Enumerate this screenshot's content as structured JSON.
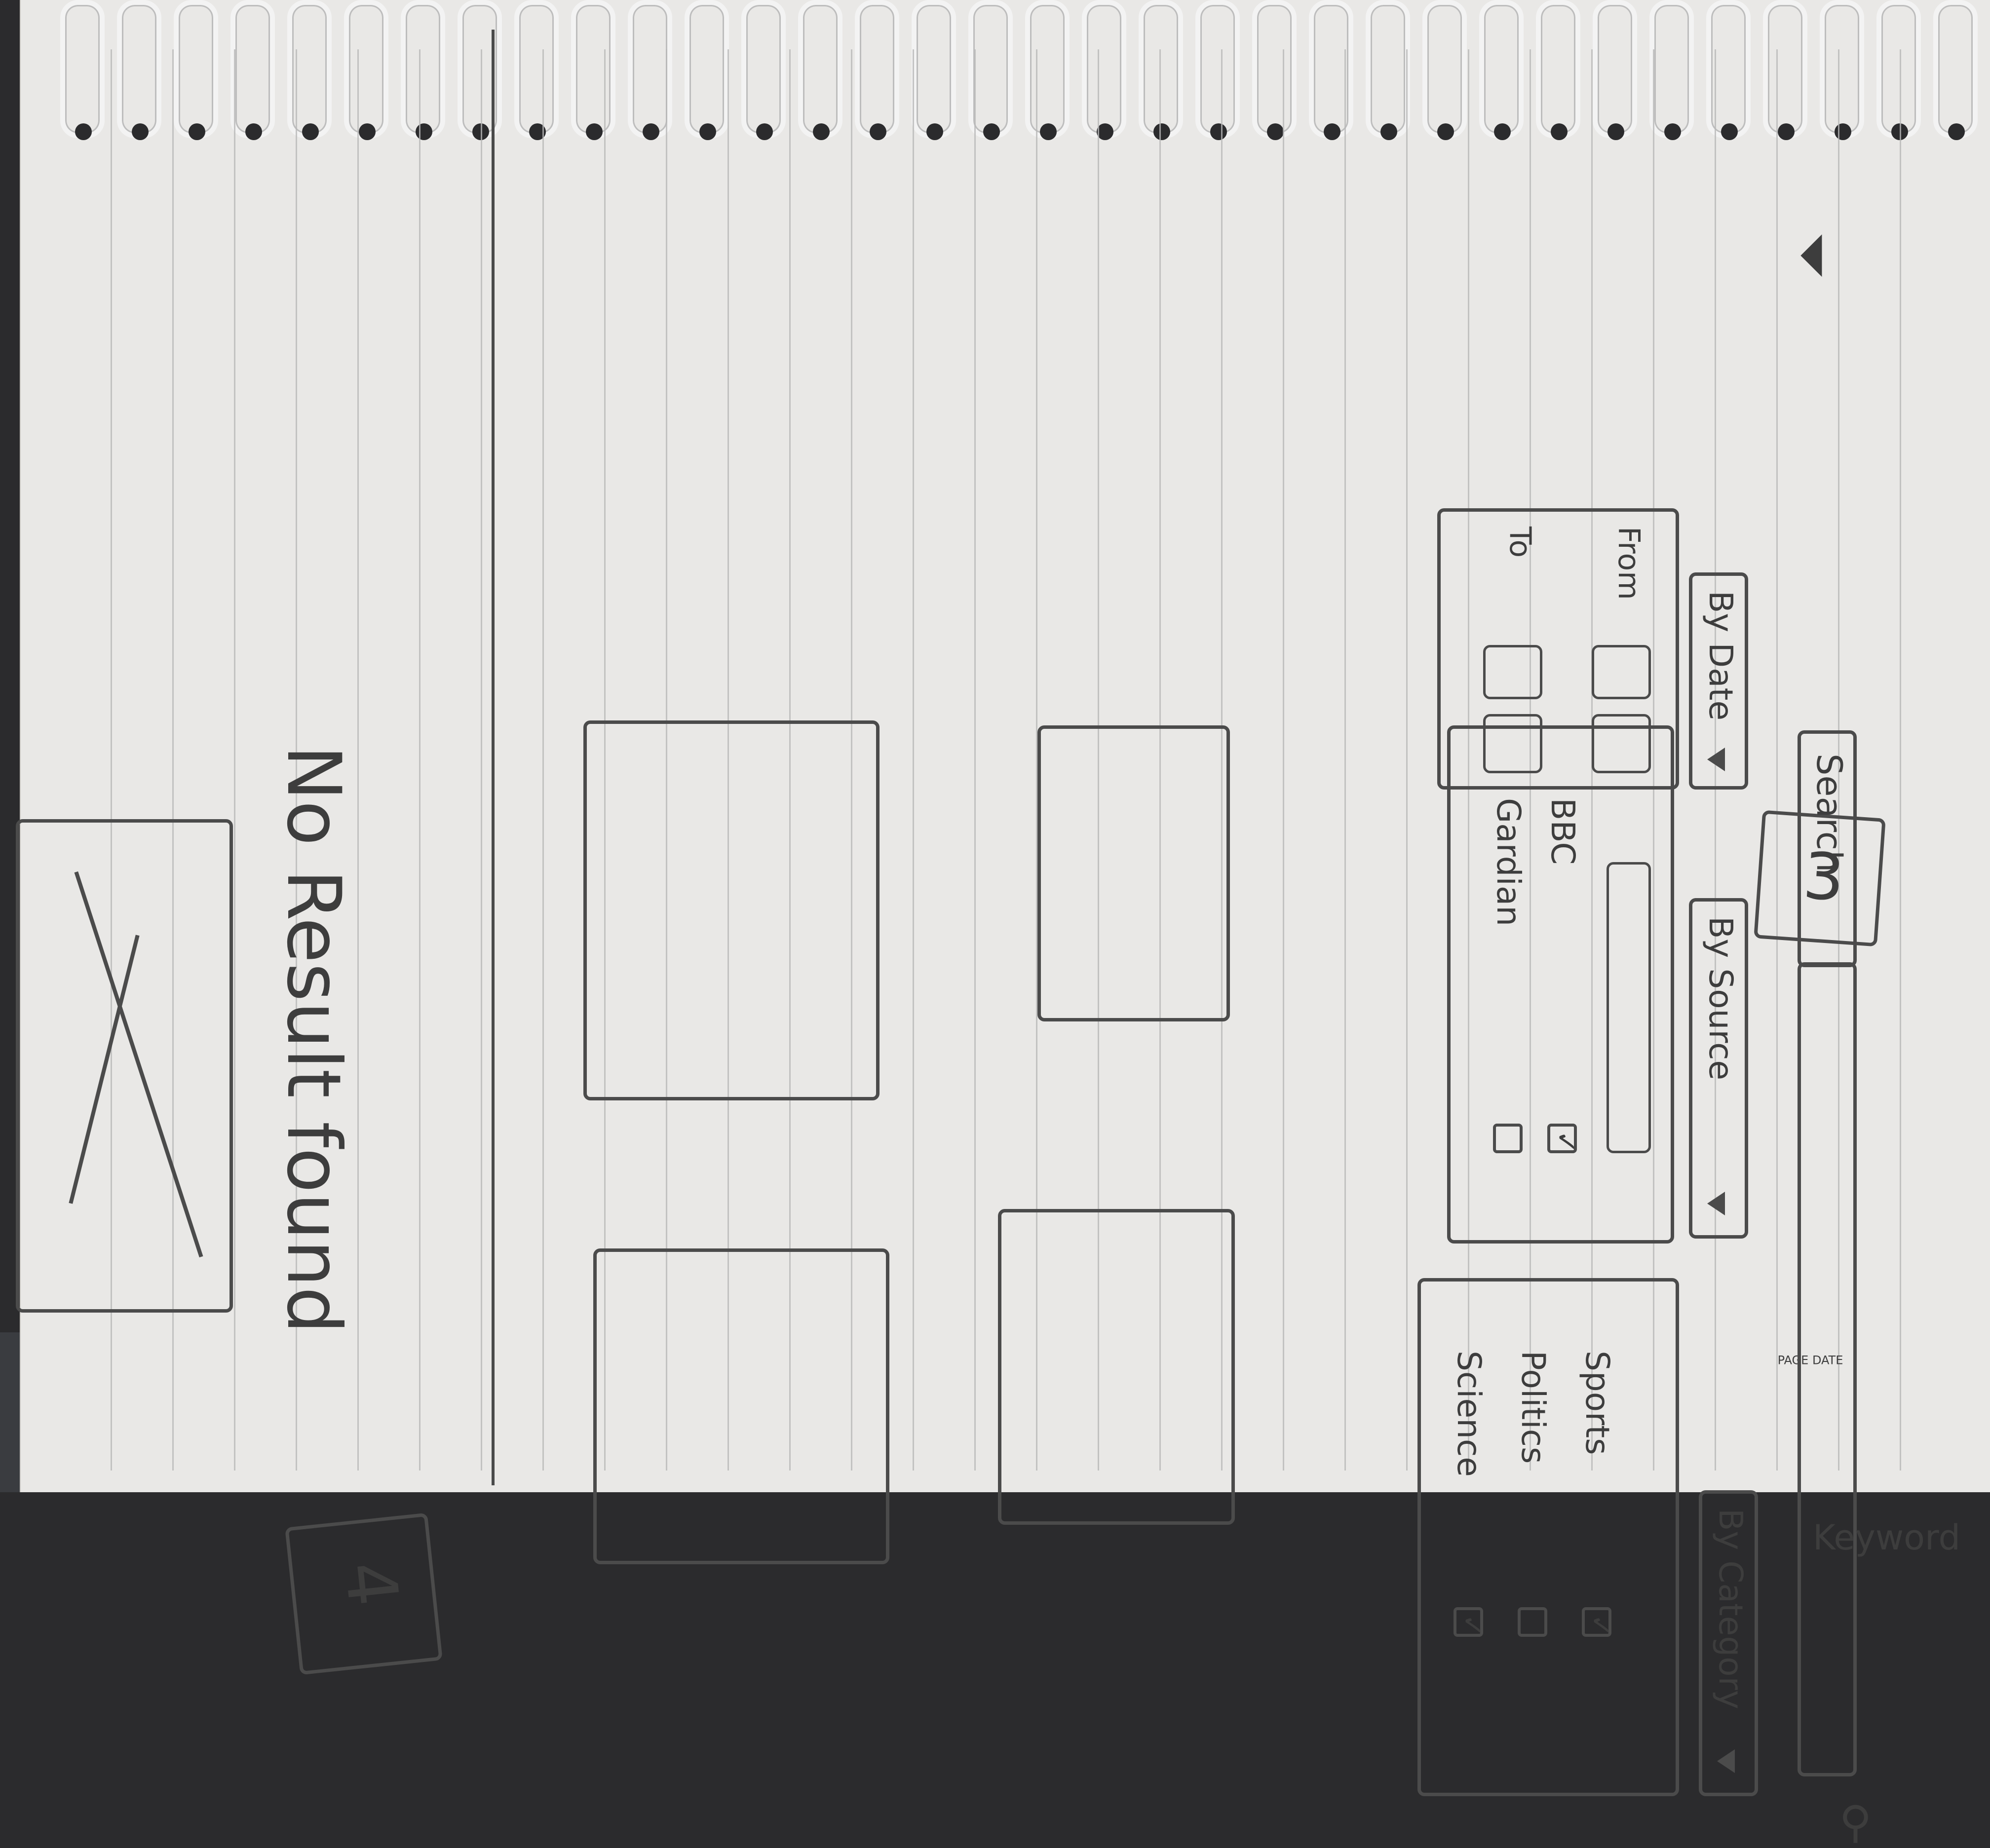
{
  "page": {
    "page_number": "3",
    "header_label": "PAGE\nDATE",
    "keyword_placeholder": "Keyword",
    "search_label": "Search"
  },
  "filters": {
    "category": {
      "label": "By Category",
      "items": [
        {
          "label": "Sports",
          "checked": true
        },
        {
          "label": "Politics",
          "checked": false
        },
        {
          "label": "Science",
          "checked": true
        }
      ]
    },
    "source": {
      "label": "By Source",
      "items": [
        {
          "label": "BBC",
          "checked": true
        },
        {
          "label": "Gardian",
          "checked": false
        }
      ]
    },
    "date": {
      "label": "By Date",
      "from_label": "From",
      "to_label": "To"
    }
  },
  "results_page": {
    "page_number": "4",
    "empty_message": "No Result found"
  },
  "colors": {
    "paper": "#e9e8e6",
    "pencil": "#4b4b4b",
    "rule": "#b8b8b8",
    "desk": "#2b2b2d"
  },
  "icons": [
    "search-icon",
    "filter-icon",
    "dropdown-triangle-icon",
    "checkbox-icon",
    "empty-state-image-icon"
  ]
}
